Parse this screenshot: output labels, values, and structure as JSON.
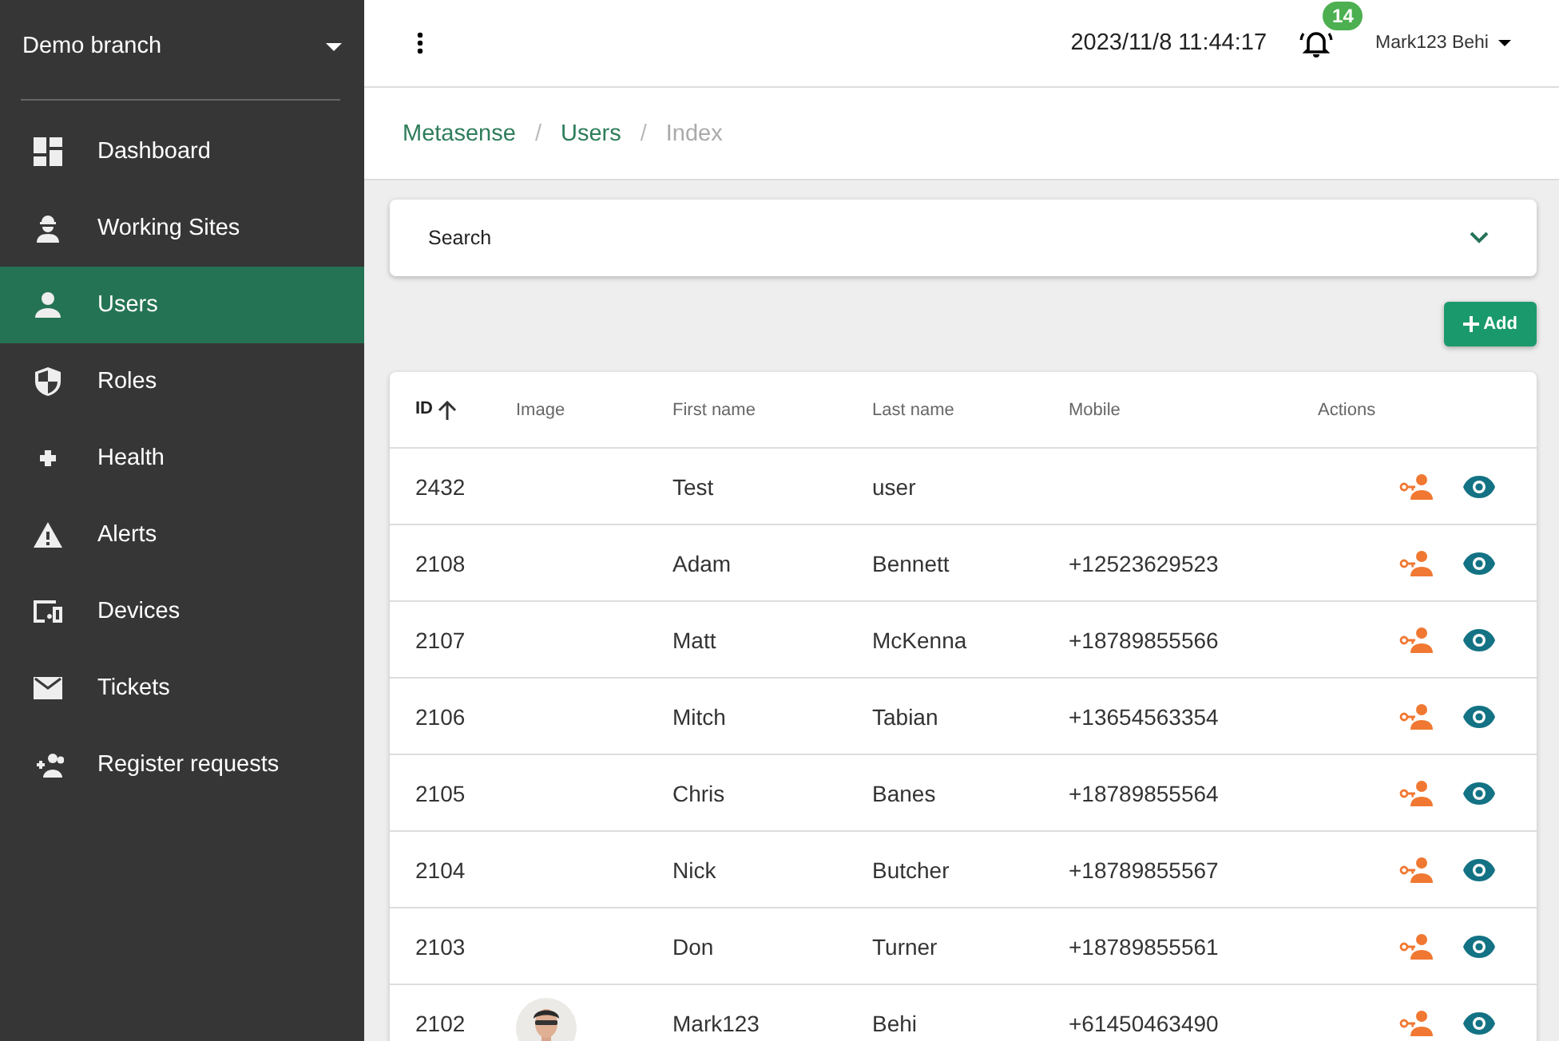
{
  "sidebar": {
    "branch": "Demo branch",
    "items": [
      {
        "label": "Dashboard",
        "selected": false
      },
      {
        "label": "Working Sites",
        "selected": false
      },
      {
        "label": "Users",
        "selected": true
      },
      {
        "label": "Roles",
        "selected": false
      },
      {
        "label": "Health",
        "selected": false
      },
      {
        "label": "Alerts",
        "selected": false
      },
      {
        "label": "Devices",
        "selected": false
      },
      {
        "label": "Tickets",
        "selected": false
      },
      {
        "label": "Register requests",
        "selected": false
      }
    ]
  },
  "header": {
    "datetime": "2023/11/8 11:44:17",
    "notifications": "14",
    "user": "Mark123 Behi"
  },
  "breadcrumb": [
    {
      "label": "Metasense",
      "current": false
    },
    {
      "label": "Users",
      "current": false
    },
    {
      "label": "Index",
      "current": true
    }
  ],
  "breadcrumb_separator": "/",
  "search": {
    "label": "Search",
    "expanded": false
  },
  "add_button": "Add",
  "table": {
    "columns": [
      {
        "label": "ID",
        "sorted": true
      },
      {
        "label": "Image",
        "sorted": false
      },
      {
        "label": "First name",
        "sorted": false
      },
      {
        "label": "Last name",
        "sorted": false
      },
      {
        "label": "Mobile",
        "sorted": false
      },
      {
        "label": "Actions",
        "sorted": false
      }
    ],
    "rows": [
      {
        "id": "2432",
        "first": "Test",
        "last": "user"
      },
      {
        "id": "2108",
        "first": "Adam",
        "last": "Bennett",
        "mobile": "+12523629523"
      },
      {
        "id": "2107",
        "first": "Matt",
        "last": "McKenna",
        "mobile": "+18789855566"
      },
      {
        "id": "2106",
        "first": "Mitch",
        "last": "Tabian",
        "mobile": "+13654563354"
      },
      {
        "id": "2105",
        "first": "Chris",
        "last": "Banes",
        "mobile": "+18789855564"
      },
      {
        "id": "2104",
        "first": "Nick",
        "last": "Butcher",
        "mobile": "+18789855567"
      },
      {
        "id": "2103",
        "first": "Don",
        "last": "Turner",
        "mobile": "+18789855561"
      },
      {
        "id": "2102",
        "first": "Mark123",
        "last": "Behi",
        "mobile": "+61450463490"
      }
    ]
  }
}
